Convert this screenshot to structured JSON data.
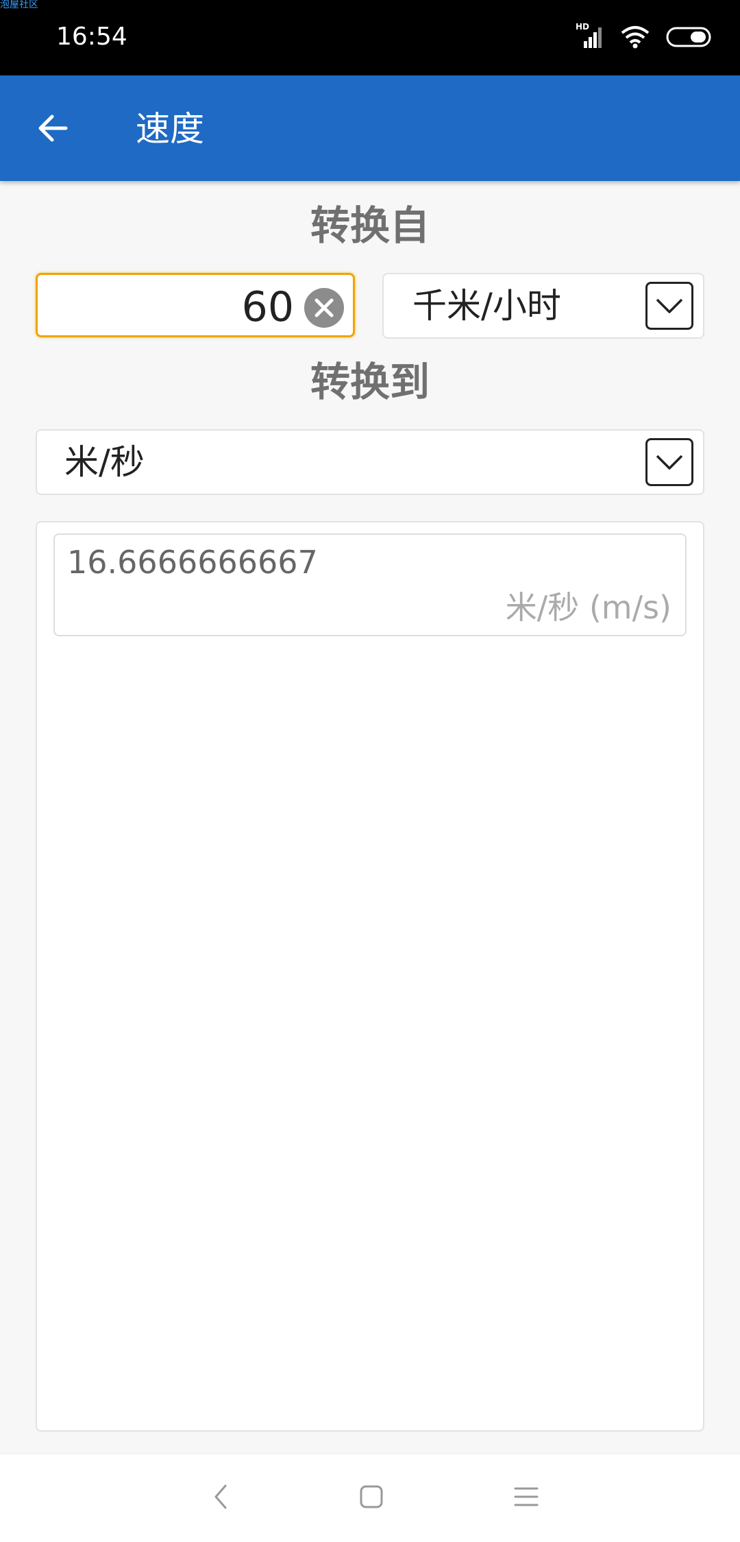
{
  "status_bar": {
    "watermark": "泡屋社区",
    "time": "16:54",
    "hd_label": "HD"
  },
  "app_bar": {
    "title": "速度"
  },
  "from_section": {
    "label": "转换自",
    "input_value": "60",
    "unit_selected": "千米/小时"
  },
  "to_section": {
    "label": "转换到",
    "unit_selected": "米/秒"
  },
  "results": [
    {
      "value": "16.6666666667",
      "unit": "米/秒 (m/s)"
    }
  ],
  "colors": {
    "app_bar": "#1e6ac4",
    "input_focus_border": "#f0a500",
    "label_gray": "#707070"
  }
}
